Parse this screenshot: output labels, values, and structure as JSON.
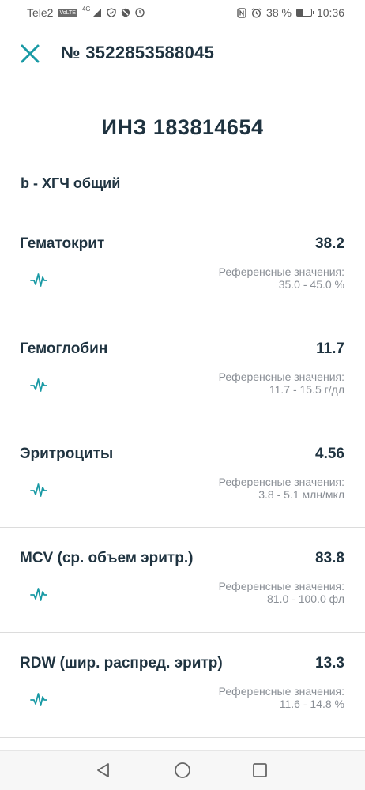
{
  "status_bar": {
    "carrier": "Tele2",
    "volte": "VoLTE",
    "network": "4G",
    "battery_percent": "38 %",
    "battery_level": 0.38,
    "time": "10:36"
  },
  "header": {
    "title": "№ 3522853588045"
  },
  "main": {
    "title": "ИНЗ 183814654",
    "section": "b - ХГЧ общий",
    "results": [
      {
        "name": "Гематокрит",
        "value": "38.2",
        "ref_label": "Референсные значения:",
        "ref_range": "35.0 - 45.0 %"
      },
      {
        "name": "Гемоглобин",
        "value": "11.7",
        "ref_label": "Референсные значения:",
        "ref_range": "11.7 - 15.5 г/дл"
      },
      {
        "name": "Эритроциты",
        "value": "4.56",
        "ref_label": "Референсные значения:",
        "ref_range": "3.8 - 5.1 млн/мкл"
      },
      {
        "name": "MCV (ср. объем эритр.)",
        "value": "83.8",
        "ref_label": "Референсные значения:",
        "ref_range": "81.0 - 100.0 фл"
      },
      {
        "name": "RDW (шир. распред. эритр)",
        "value": "13.3",
        "ref_label": "Референсные значения:",
        "ref_range": "11.6 - 14.8 %"
      }
    ]
  },
  "colors": {
    "accent": "#1a9aa5",
    "text_dark": "#1f3340",
    "text_muted": "#8a8f96"
  },
  "icons": {
    "close": "close-icon",
    "pulse": "pulse-icon",
    "back": "back-icon",
    "home": "home-icon",
    "recents": "recents-icon"
  }
}
